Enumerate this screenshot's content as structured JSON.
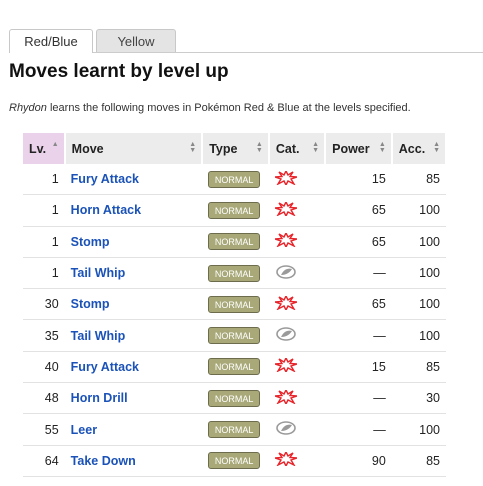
{
  "tabs": [
    {
      "label": "Red/Blue",
      "active": true
    },
    {
      "label": "Yellow",
      "active": false
    }
  ],
  "heading": "Moves learnt by level up",
  "intro": {
    "pokemon": "Rhydon",
    "text": " learns the following moves in Pokémon Red & Blue at the levels specified."
  },
  "table": {
    "headers": {
      "lv": "Lv.",
      "move": "Move",
      "type": "Type",
      "cat": "Cat.",
      "power": "Power",
      "acc": "Acc."
    },
    "rows": [
      {
        "lv": "1",
        "move": "Fury Attack",
        "type": "NORMAL",
        "cat": "physical",
        "power": "15",
        "acc": "85"
      },
      {
        "lv": "1",
        "move": "Horn Attack",
        "type": "NORMAL",
        "cat": "physical",
        "power": "65",
        "acc": "100"
      },
      {
        "lv": "1",
        "move": "Stomp",
        "type": "NORMAL",
        "cat": "physical",
        "power": "65",
        "acc": "100"
      },
      {
        "lv": "1",
        "move": "Tail Whip",
        "type": "NORMAL",
        "cat": "status",
        "power": "—",
        "acc": "100"
      },
      {
        "lv": "30",
        "move": "Stomp",
        "type": "NORMAL",
        "cat": "physical",
        "power": "65",
        "acc": "100"
      },
      {
        "lv": "35",
        "move": "Tail Whip",
        "type": "NORMAL",
        "cat": "status",
        "power": "—",
        "acc": "100"
      },
      {
        "lv": "40",
        "move": "Fury Attack",
        "type": "NORMAL",
        "cat": "physical",
        "power": "15",
        "acc": "85"
      },
      {
        "lv": "48",
        "move": "Horn Drill",
        "type": "NORMAL",
        "cat": "physical",
        "power": "—",
        "acc": "30"
      },
      {
        "lv": "55",
        "move": "Leer",
        "type": "NORMAL",
        "cat": "status",
        "power": "—",
        "acc": "100"
      },
      {
        "lv": "64",
        "move": "Take Down",
        "type": "NORMAL",
        "cat": "physical",
        "power": "90",
        "acc": "85"
      }
    ]
  },
  "colors": {
    "link": "#1a52b8",
    "normal_type": "#a8a878",
    "physical_icon": "#e8242a",
    "status_icon": "#9a9a9a",
    "sorted_header": "#ead2ea"
  }
}
